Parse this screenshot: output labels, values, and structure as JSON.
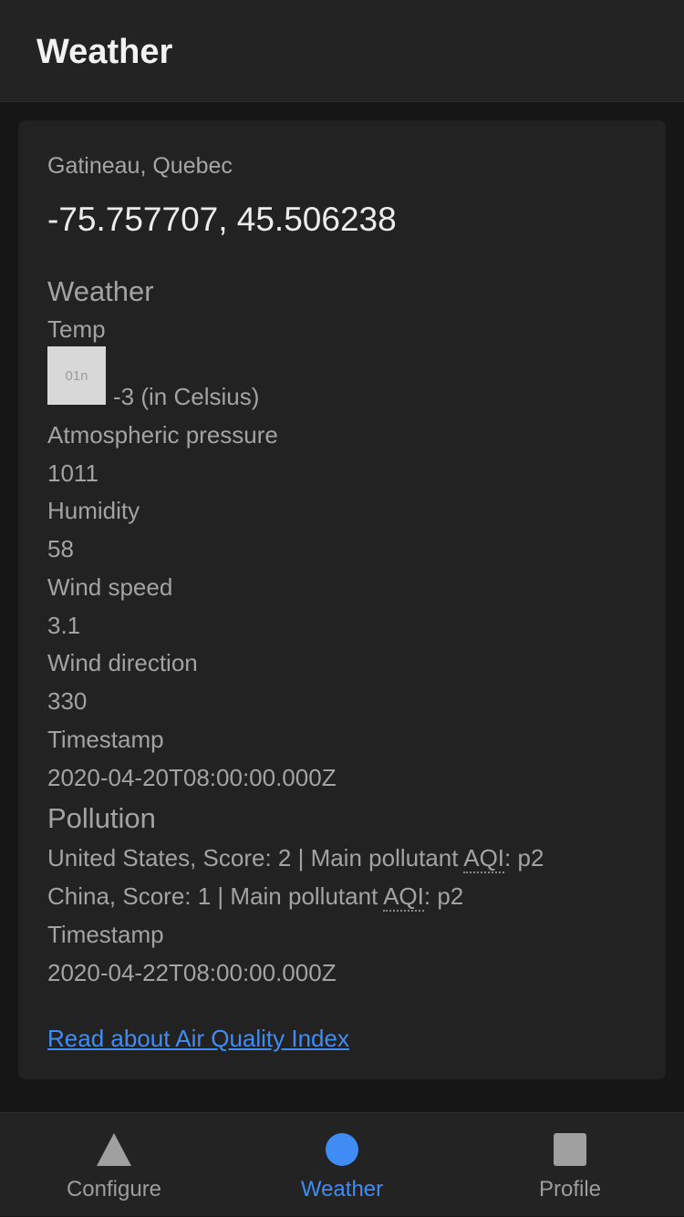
{
  "header": {
    "title": "Weather"
  },
  "card": {
    "location": "Gatineau, Quebec",
    "coordinates": "-75.757707, 45.506238",
    "weather": {
      "section_title": "Weather",
      "temp_label": "Temp",
      "icon_code": "01n",
      "temp_value": "-3 (in Celsius)",
      "pressure_label": "Atmospheric pressure",
      "pressure_value": "1011",
      "humidity_label": "Humidity",
      "humidity_value": "58",
      "wind_speed_label": "Wind speed",
      "wind_speed_value": "3.1",
      "wind_direction_label": "Wind direction",
      "wind_direction_value": "330",
      "timestamp_label": "Timestamp",
      "timestamp_value": "2020-04-20T08:00:00.000Z"
    },
    "pollution": {
      "section_title": "Pollution",
      "us_prefix": "United States, Score: 2 | Main pollutant ",
      "us_abbr": "AQI",
      "us_suffix": ": p2",
      "china_prefix": "China, Score: 1 | Main pollutant ",
      "china_abbr": "AQI",
      "china_suffix": ": p2",
      "timestamp_label": "Timestamp",
      "timestamp_value": "2020-04-22T08:00:00.000Z"
    },
    "aqi_link": "Read about Air Quality Index"
  },
  "tabbar": {
    "tabs": [
      {
        "label": "Configure",
        "icon": "triangle-icon"
      },
      {
        "label": "Weather",
        "icon": "circle-icon"
      },
      {
        "label": "Profile",
        "icon": "square-icon"
      }
    ],
    "active_color": "#3f8cf5",
    "inactive_color": "#9d9d9d"
  }
}
